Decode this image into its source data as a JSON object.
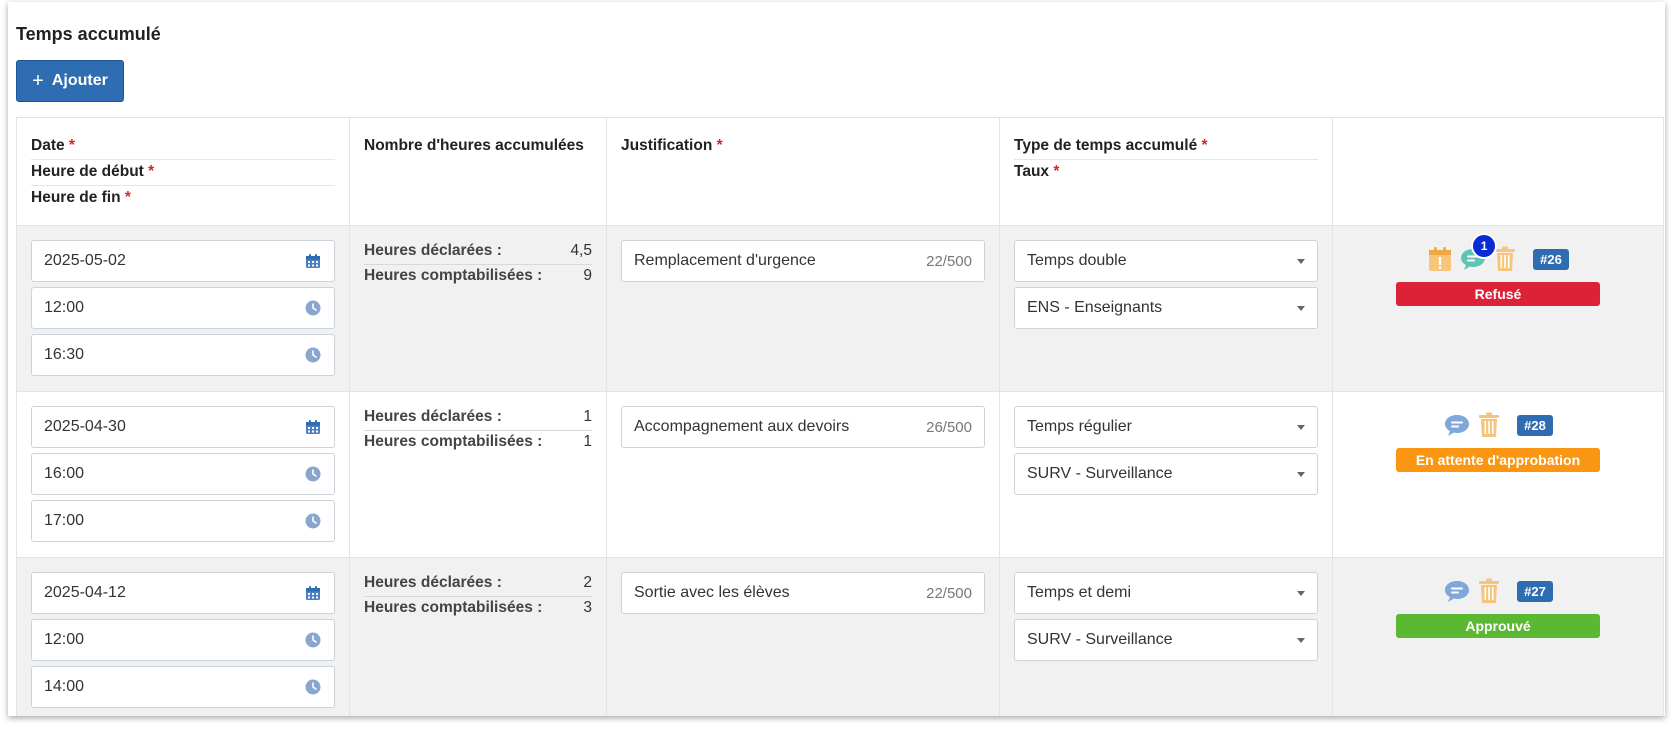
{
  "section_title": "Temps accumulé",
  "add_button_label": "Ajouter",
  "required_mark": "*",
  "columns": {
    "date": "Date",
    "start": "Heure de début",
    "end": "Heure de fin",
    "hours": "Nombre d'heures accumulées",
    "justification": "Justification",
    "type": "Type de temps accumulé",
    "rate": "Taux"
  },
  "labels": {
    "declared": "Heures déclarées :",
    "counted": "Heures comptabilisées :"
  },
  "rows": [
    {
      "date": "2025-05-02",
      "start": "12:00",
      "end": "16:30",
      "declared": "4,5",
      "counted": "9",
      "justification": "Remplacement d'urgence",
      "char_count": "22/500",
      "type": "Temps double",
      "rate": "ENS - Enseignants",
      "id": "#26",
      "status": "Refusé",
      "status_color": "#dc2237",
      "comment_count": "1"
    },
    {
      "date": "2025-04-30",
      "start": "16:00",
      "end": "17:00",
      "declared": "1",
      "counted": "1",
      "justification": "Accompagnement aux devoirs",
      "char_count": "26/500",
      "type": "Temps régulier",
      "rate": "SURV - Surveillance",
      "id": "#28",
      "status": "En attente d'approbation",
      "status_color": "#fa9611"
    },
    {
      "date": "2025-04-12",
      "start": "12:00",
      "end": "14:00",
      "declared": "2",
      "counted": "3",
      "justification": "Sortie avec les élèves",
      "char_count": "22/500",
      "type": "Temps et demi",
      "rate": "SURV - Surveillance",
      "id": "#27",
      "status": "Approuvé",
      "status_color": "#5bb832"
    }
  ],
  "colors": {
    "primary": "#2f6db3",
    "required": "#d9262c",
    "warning_icon": "#f6c47a",
    "comment_icon": "#7fa8d8",
    "comment_icon_active": "#5fc4b6",
    "trash_icon": "#f6c47a"
  },
  "icons": {
    "calendar": "calendar-icon",
    "clock": "clock-icon",
    "comment": "comment-icon",
    "trash": "trash-icon",
    "warning": "calendar-warning-icon",
    "caret": "chevron-down-icon"
  }
}
